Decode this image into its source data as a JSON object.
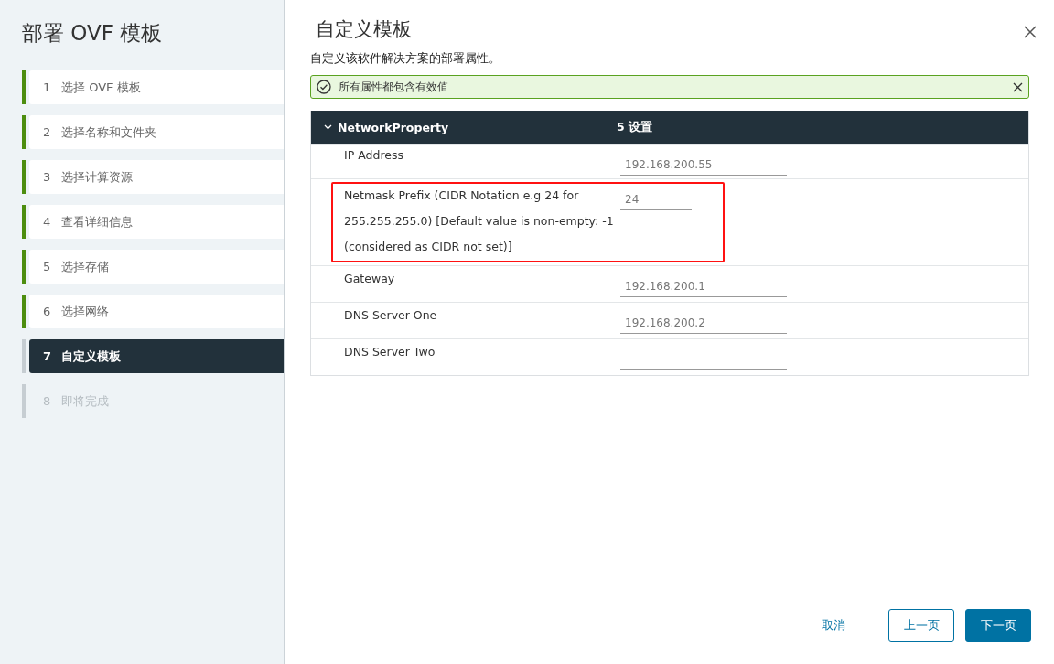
{
  "wizard": {
    "title": "部署 OVF 模板",
    "steps": [
      {
        "number": "1",
        "label": "选择 OVF 模板",
        "completed": true,
        "selected": false,
        "disabled": false
      },
      {
        "number": "2",
        "label": "选择名称和文件夹",
        "completed": true,
        "selected": false,
        "disabled": false
      },
      {
        "number": "3",
        "label": "选择计算资源",
        "completed": true,
        "selected": false,
        "disabled": false
      },
      {
        "number": "4",
        "label": "查看详细信息",
        "completed": true,
        "selected": false,
        "disabled": false
      },
      {
        "number": "5",
        "label": "选择存储",
        "completed": true,
        "selected": false,
        "disabled": false
      },
      {
        "number": "6",
        "label": "选择网络",
        "completed": true,
        "selected": false,
        "disabled": false
      },
      {
        "number": "7",
        "label": "自定义模板",
        "completed": false,
        "selected": true,
        "disabled": false
      },
      {
        "number": "8",
        "label": "即将完成",
        "completed": false,
        "selected": false,
        "disabled": true
      }
    ]
  },
  "page": {
    "title": "自定义模板",
    "description": "自定义该软件解决方案的部署属性。",
    "alert": {
      "kind": "success",
      "message": "所有属性都包含有效值"
    },
    "group": {
      "name": "NetworkProperty",
      "expanded": true,
      "count": "5 设置",
      "properties": [
        {
          "label": "IP Address",
          "value": "192.168.200.55",
          "short": false,
          "highlighted": false
        },
        {
          "label": "Netmask Prefix (CIDR Notation e.g 24 for 255.255.255.0) [Default value is non-empty: -1 (considered as CIDR not set)]",
          "value": "24",
          "short": true,
          "highlighted": true
        },
        {
          "label": "Gateway",
          "value": "192.168.200.1",
          "short": false,
          "highlighted": false
        },
        {
          "label": "DNS Server One",
          "value": "192.168.200.2",
          "short": false,
          "highlighted": false
        },
        {
          "label": "DNS Server Two",
          "short": false,
          "highlighted": false
        }
      ]
    }
  },
  "buttons": [
    {
      "label": "取消",
      "kind": "flat"
    },
    {
      "label": "上一页",
      "kind": "outline"
    },
    {
      "label": "下一页",
      "kind": "primary"
    }
  ]
}
